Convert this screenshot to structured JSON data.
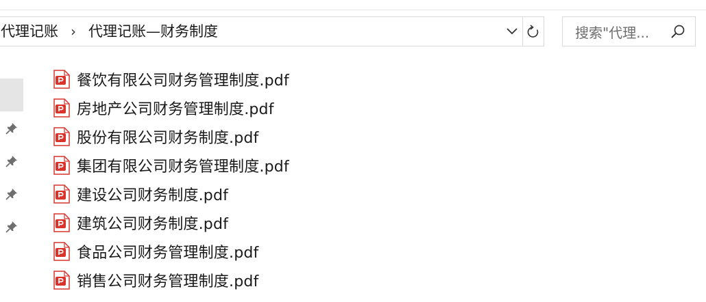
{
  "address_bar": {
    "breadcrumbs": [
      "代理记账",
      "代理记账—财务制度"
    ],
    "separator": "›"
  },
  "search": {
    "placeholder": "搜索\"代理..."
  },
  "files": [
    {
      "name": "餐饮有限公司财务管理制度.pdf",
      "icon": "pdf-file-icon"
    },
    {
      "name": "房地产公司财务管理制度.pdf",
      "icon": "pdf-file-icon"
    },
    {
      "name": "股份有限公司财务制度.pdf",
      "icon": "pdf-file-icon"
    },
    {
      "name": "集团有限公司财务管理制度.pdf",
      "icon": "pdf-file-icon"
    },
    {
      "name": "建设公司财务制度.pdf",
      "icon": "pdf-file-icon"
    },
    {
      "name": "建筑公司财务制度.pdf",
      "icon": "pdf-file-icon"
    },
    {
      "name": "食品公司财务管理制度.pdf",
      "icon": "pdf-file-icon"
    },
    {
      "name": "销售公司财务管理制度.pdf",
      "icon": "pdf-file-icon"
    }
  ],
  "nav_pane": {
    "pinned_items": 4
  },
  "colors": {
    "pdf_red": "#d9342b",
    "border": "#d9d9d9",
    "selection": "#e5e5e5"
  }
}
